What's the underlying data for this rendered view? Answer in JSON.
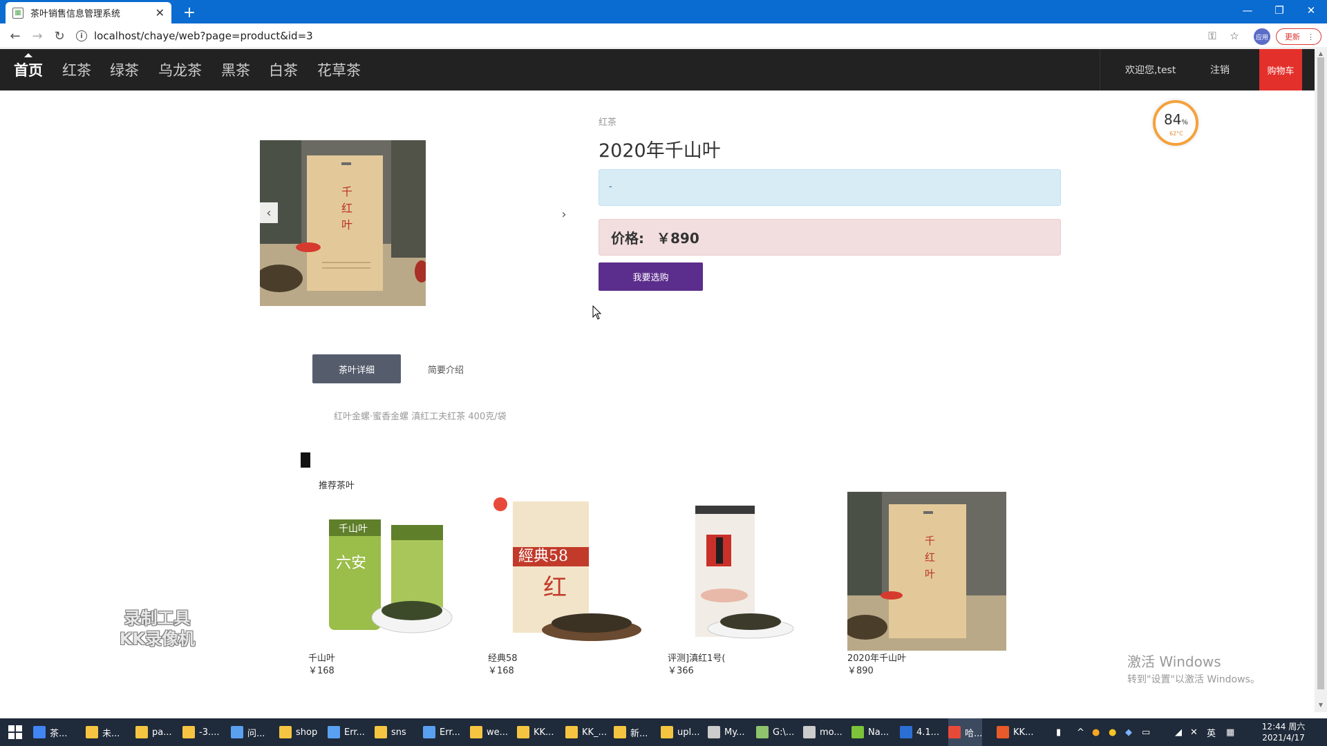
{
  "browser": {
    "tab_title": "茶叶销售信息管理系统",
    "url": "localhost/chaye/web?page=product&id=3",
    "profile_label": "应用",
    "update_label": "更新"
  },
  "navbar": {
    "items": [
      {
        "label": "首页",
        "active": true
      },
      {
        "label": "红茶"
      },
      {
        "label": "绿茶"
      },
      {
        "label": "乌龙茶"
      },
      {
        "label": "黑茶"
      },
      {
        "label": "白茶"
      },
      {
        "label": "花草茶"
      }
    ],
    "welcome": "欢迎您,test",
    "logout": "注销",
    "cart": "购物车"
  },
  "product": {
    "category": "红茶",
    "title": "2020年千山叶",
    "description": "-",
    "price_label": "价格:",
    "price": "￥890",
    "buy_button": "我要选购"
  },
  "gauge": {
    "percent": "84",
    "unit": "%",
    "temp": "62°C"
  },
  "detail_tabs": {
    "active": "茶叶详细",
    "inactive": "简要介绍",
    "content": "红叶金螺·蜜香金螺 滇红工夫红茶 400克/袋"
  },
  "recommend": {
    "heading": "推荐茶叶",
    "items": [
      {
        "name": "千山叶",
        "price": "￥168"
      },
      {
        "name": "经典58",
        "price": "￥168"
      },
      {
        "name": "评测]滇红1号(",
        "price": "￥366"
      },
      {
        "name": "2020年千山叶",
        "price": "￥890"
      }
    ]
  },
  "overlay": {
    "recorder_line1": "录制工具",
    "recorder_line2": "KK录像机",
    "activate_title": "激活 Windows",
    "activate_sub": "转到\"设置\"以激活 Windows。"
  },
  "taskbar": {
    "items": [
      {
        "label": "茶..."
      },
      {
        "label": "未..."
      },
      {
        "label": "pa..."
      },
      {
        "label": "-3...."
      },
      {
        "label": "问..."
      },
      {
        "label": "shop"
      },
      {
        "label": "Err..."
      },
      {
        "label": "sns"
      },
      {
        "label": "Err..."
      },
      {
        "label": "we..."
      },
      {
        "label": "KK..."
      },
      {
        "label": "KK_..."
      },
      {
        "label": "新..."
      },
      {
        "label": "upl..."
      },
      {
        "label": "My..."
      },
      {
        "label": "G:\\..."
      },
      {
        "label": "mo..."
      },
      {
        "label": "Na..."
      },
      {
        "label": "4.1..."
      },
      {
        "label": "哈..."
      },
      {
        "label": "KK..."
      }
    ],
    "ime": "英",
    "time": "12:44 周六",
    "date": "2021/4/17"
  },
  "colors": {
    "navbar_bg": "#222222",
    "cart_red": "#e3302b",
    "buy_purple": "#5b2d8c",
    "tab_active": "#555d6d",
    "info_bg": "#d8ecf6",
    "price_bg": "#f2dede",
    "browser_blue": "#0a6bd0"
  }
}
